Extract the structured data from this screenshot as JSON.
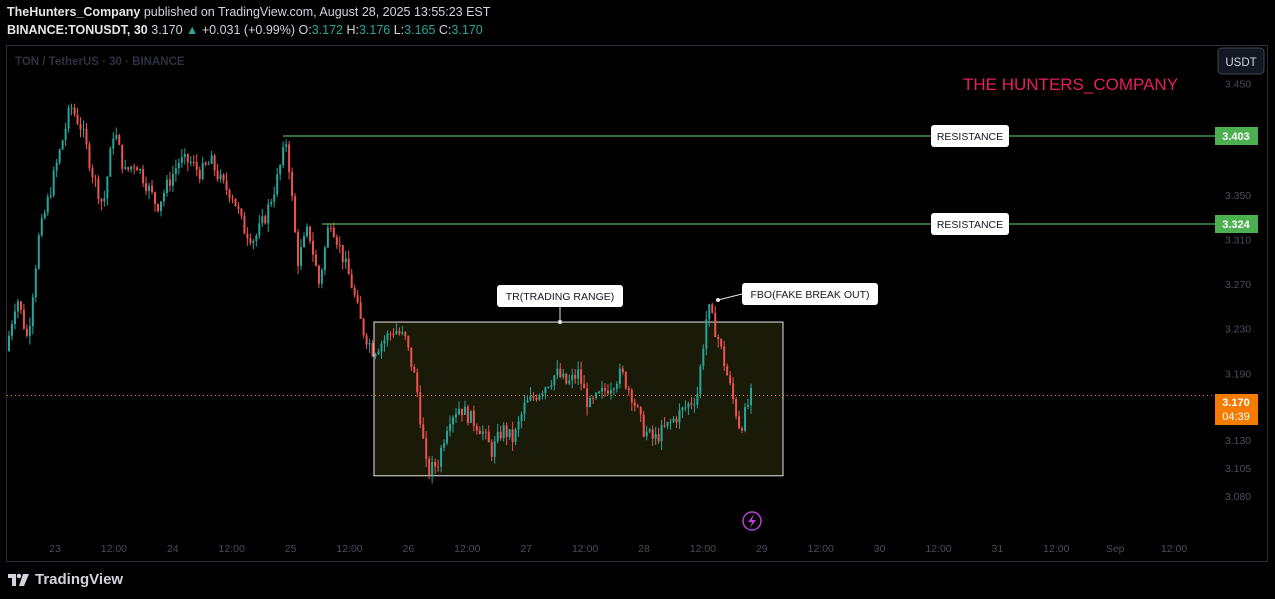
{
  "header": {
    "author": "TheHunters_Company",
    "published_text": "published on TradingView.com, August 28, 2025 13:55:23 EST",
    "symbol": "BINANCE:TONUSDT, 30",
    "last": "3.170",
    "change": "+0.031 (+0.99%)",
    "o_label": "O:",
    "o": "3.172",
    "h_label": "H:",
    "h": "3.176",
    "l_label": "L:",
    "l": "3.165",
    "c_label": "C:",
    "c": "3.170"
  },
  "watermark": "TON / TetherUS · 30 · BINANCE",
  "currency_button": "USDT",
  "brand_text": "THE HUNTERS_COMPANY",
  "footer": {
    "logo_text": "TradingView",
    "logo_icon": "tradingview-logo-icon"
  },
  "colors": {
    "up": "#26a69a",
    "down": "#ef5350",
    "resistance": "#4caf50",
    "brand": "#e91e63",
    "last_price": "#f57c00",
    "range_fill": "#1e1e0a"
  },
  "chart_data": {
    "type": "candlestick",
    "symbol": "TONUSDT",
    "timeframe": "30",
    "y_ticks": [
      "3.450",
      "3.350",
      "3.310",
      "3.270",
      "3.230",
      "3.190",
      "3.130",
      "3.105",
      "3.080"
    ],
    "x_ticks": [
      "23",
      "12:00",
      "24",
      "12:00",
      "25",
      "12:00",
      "26",
      "12:00",
      "27",
      "12:00",
      "28",
      "12:00",
      "29",
      "12:00",
      "30",
      "12:00",
      "31",
      "12:00",
      "Sep",
      "12:00"
    ],
    "resistance_levels": [
      {
        "label": "RESISTANCE",
        "value": 3.403,
        "value_label": "3.403"
      },
      {
        "label": "RESISTANCE",
        "value": 3.324,
        "value_label": "3.324"
      }
    ],
    "last_price": {
      "value": 3.17,
      "label": "3.170",
      "countdown": "04:39"
    },
    "annotations": [
      {
        "label": "TR(TRADING RANGE)",
        "type": "box",
        "top": 3.236,
        "bottom": 3.098
      },
      {
        "label": "FBO(FAKE BREAK OUT)",
        "type": "callout"
      }
    ],
    "price_path": [
      3.21,
      3.26,
      3.22,
      3.31,
      3.35,
      3.39,
      3.43,
      3.41,
      3.37,
      3.34,
      3.41,
      3.37,
      3.38,
      3.36,
      3.34,
      3.36,
      3.38,
      3.38,
      3.37,
      3.38,
      3.36,
      3.35,
      3.32,
      3.31,
      3.33,
      3.36,
      3.4,
      3.29,
      3.32,
      3.27,
      3.33,
      3.3,
      3.27,
      3.23,
      3.21,
      3.22,
      3.23,
      3.22,
      3.18,
      3.1,
      3.11,
      3.15,
      3.16,
      3.15,
      3.14,
      3.12,
      3.14,
      3.13,
      3.16,
      3.17,
      3.18,
      3.19,
      3.18,
      3.19,
      3.16,
      3.17,
      3.18,
      3.19,
      3.17,
      3.14,
      3.13,
      3.14,
      3.15,
      3.16,
      3.17,
      3.25,
      3.22,
      3.18,
      3.14,
      3.17
    ]
  }
}
